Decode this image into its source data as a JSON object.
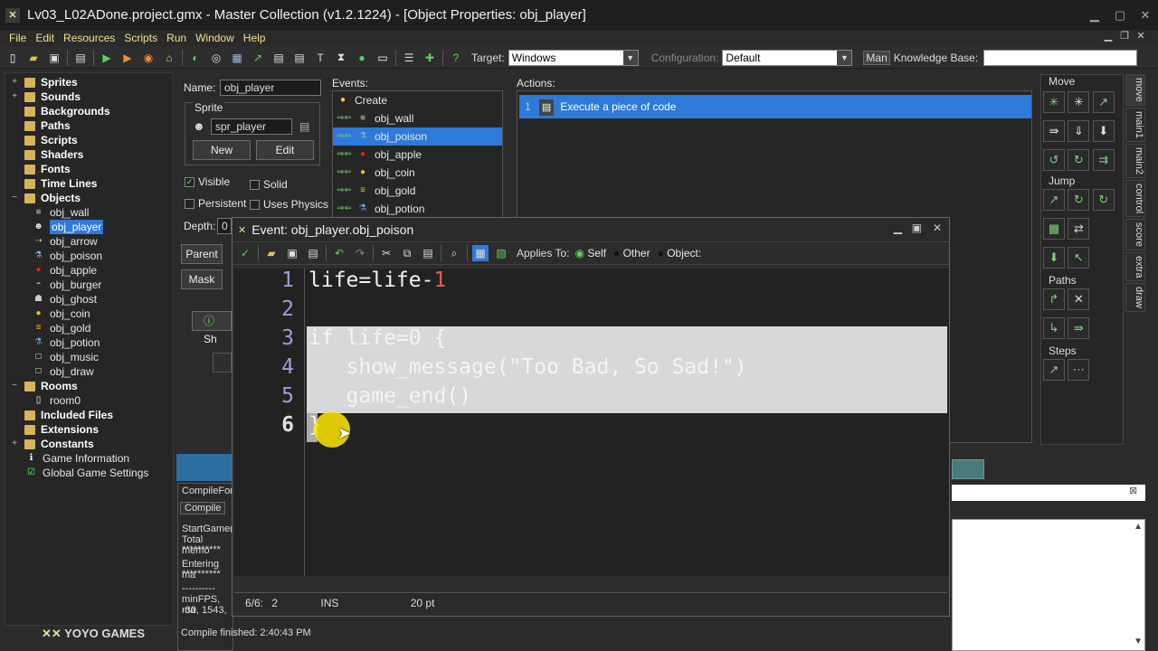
{
  "window": {
    "title": "Lv03_L02ADone.project.gmx  -  Master Collection (v1.2.1224) - [Object Properties: obj_player]",
    "app_icon": "gm-icon"
  },
  "menu": [
    "File",
    "Edit",
    "Resources",
    "Scripts",
    "Run",
    "Window",
    "Help"
  ],
  "toolbar": {
    "target_label": "Target:",
    "target_value": "Windows",
    "config_label": "Configuration:",
    "config_value": "Default",
    "manual_label": "Man",
    "kb_label": "Knowledge Base:"
  },
  "tree": {
    "groups": [
      {
        "label": "Sprites",
        "expander": "+"
      },
      {
        "label": "Sounds",
        "expander": "+"
      },
      {
        "label": "Backgrounds",
        "expander": ""
      },
      {
        "label": "Paths",
        "expander": ""
      },
      {
        "label": "Scripts",
        "expander": ""
      },
      {
        "label": "Shaders",
        "expander": ""
      },
      {
        "label": "Fonts",
        "expander": ""
      },
      {
        "label": "Time Lines",
        "expander": ""
      },
      {
        "label": "Objects",
        "expander": "−"
      }
    ],
    "objects": [
      {
        "label": "obj_wall",
        "icon": "■",
        "color": "#8a7a6a"
      },
      {
        "label": "obj_player",
        "icon": "☻",
        "color": "#dddddd"
      },
      {
        "label": "obj_arrow",
        "icon": "➝",
        "color": "#bbbbbb"
      },
      {
        "label": "obj_poison",
        "icon": "⚗",
        "color": "#7fb2e0"
      },
      {
        "label": "obj_apple",
        "icon": "●",
        "color": "#e02020"
      },
      {
        "label": "obj_burger",
        "icon": "◓",
        "color": "#d08a30"
      },
      {
        "label": "obj_ghost",
        "icon": "☗",
        "color": "#cccccc"
      },
      {
        "label": "obj_coin",
        "icon": "●",
        "color": "#e6c020"
      },
      {
        "label": "obj_gold",
        "icon": "≡",
        "color": "#e6c020"
      },
      {
        "label": "obj_potion",
        "icon": "⚗",
        "color": "#6fa0e0"
      },
      {
        "label": "obj_music",
        "icon": "□",
        "color": "#ffffff"
      },
      {
        "label": "obj_draw",
        "icon": "□",
        "color": "#ffffff"
      }
    ],
    "rooms_label": "Rooms",
    "room": "room0",
    "extra": [
      "Included Files",
      "Extensions",
      "Constants"
    ],
    "game_info": "Game Information",
    "global_settings": "Global Game Settings",
    "logo": "YOYO GAMES"
  },
  "object_props": {
    "name_label": "Name:",
    "name_value": "obj_player",
    "sprite_group": "Sprite",
    "sprite_value": "spr_player",
    "new_label": "New",
    "edit_label": "Edit",
    "visible_label": "Visible",
    "solid_label": "Solid",
    "persistent_label": "Persistent",
    "physics_label": "Uses Physics",
    "depth_label": "Depth:",
    "depth_value": "0",
    "parent_label": "Parent",
    "mask_label": "Mask",
    "show_label": "Sh"
  },
  "events": {
    "label": "Events:",
    "items": [
      {
        "label": "Create",
        "icon": "●",
        "color": "#f0d040",
        "arrow": false
      },
      {
        "label": "obj_wall",
        "icon": "■",
        "color": "#8a7a6a",
        "arrow": true
      },
      {
        "label": "obj_poison",
        "icon": "⚗",
        "color": "#7fb2e0",
        "arrow": true
      },
      {
        "label": "obj_apple",
        "icon": "●",
        "color": "#e02020",
        "arrow": true
      },
      {
        "label": "obj_coin",
        "icon": "●",
        "color": "#e6c020",
        "arrow": true
      },
      {
        "label": "obj_gold",
        "icon": "≡",
        "color": "#e6c020",
        "arrow": true
      },
      {
        "label": "obj_potion",
        "icon": "⚗",
        "color": "#6fa0e0",
        "arrow": true
      }
    ]
  },
  "actions": {
    "label": "Actions:",
    "item": "Execute a piece of code",
    "index": "1"
  },
  "library": {
    "tabs": [
      "move",
      "main1",
      "main2",
      "control",
      "score",
      "extra",
      "draw"
    ],
    "sections": [
      "Move",
      "Jump",
      "Paths",
      "Steps"
    ]
  },
  "editor": {
    "title": "Event: obj_player.obj_poison",
    "applies_label": "Applies To:",
    "self_label": "Self",
    "other_label": "Other",
    "object_label": "Object:",
    "line_numbers": [
      "1",
      "2",
      "3",
      "4",
      "5",
      "6"
    ],
    "lines": [
      {
        "a": "life=life-",
        "b": "1"
      },
      {
        "a": "",
        "b": ""
      },
      {
        "a": "if life=0 {",
        "b": ""
      },
      {
        "a": "   show_message(\"Too Bad, So Sad!\")",
        "b": ""
      },
      {
        "a": "   game_end()",
        "b": ""
      },
      {
        "a": "}",
        "b": ""
      }
    ],
    "status_pos": "6/6:",
    "status_col": "2",
    "status_mode": "INS",
    "status_size": "20 pt",
    "number_color": "#e8604a",
    "highlight_color": "#d8d8d8"
  },
  "compile": {
    "tab_title": "CompileFor",
    "tab": "Compile",
    "lines": [
      "StartGame(",
      "Total memo",
      "**********",
      "Entering ma",
      "**********",
      "----------",
      "minFPS, ma",
      "-30, 1543,"
    ],
    "footer": "Compile finished: 2:40:43 PM"
  }
}
